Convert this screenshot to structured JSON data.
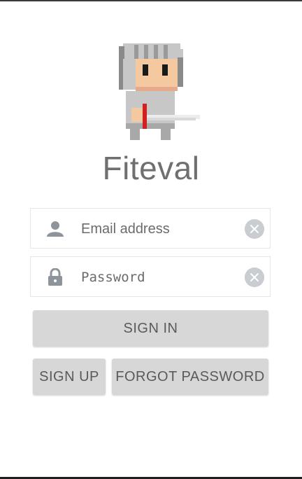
{
  "app": {
    "title": "Fiteval"
  },
  "mascot": {
    "icon": "knight-mascot-icon"
  },
  "login_form": {
    "email": {
      "placeholder": "Email address",
      "value": ""
    },
    "password": {
      "placeholder": "Password",
      "value": ""
    }
  },
  "actions": {
    "sign_in": "SIGN IN",
    "sign_up": "SIGN UP",
    "forgot_password": "FORGOT PASSWORD"
  },
  "colors": {
    "button_bg": "#d7d7d7",
    "button_text": "#5a5a5a",
    "title_text": "#6f6f6f",
    "icon_gray": "#8d949b",
    "clear_icon_bg": "#c9ccd1"
  }
}
